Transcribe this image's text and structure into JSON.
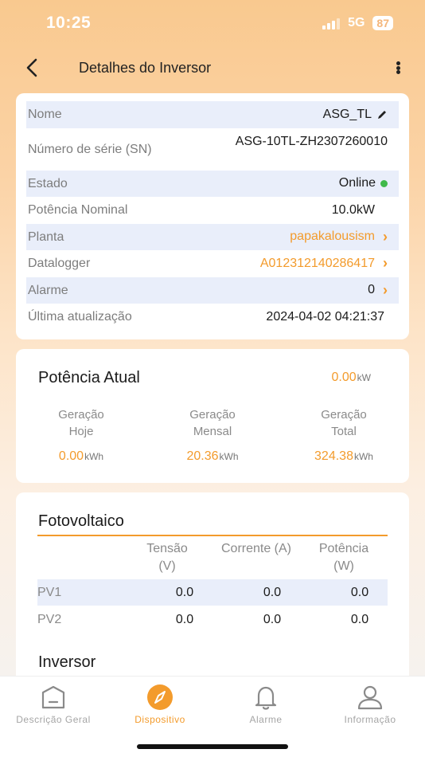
{
  "status_bar": {
    "time": "10:25",
    "network": "5G",
    "battery": "87"
  },
  "header": {
    "title": "Detalhes do Inversor"
  },
  "info": {
    "rows": [
      {
        "label": "Nome",
        "value": "ASG_TL"
      },
      {
        "label": "Número de série (SN)",
        "value": "ASG-10TL-ZH2307260010"
      },
      {
        "label": "Estado",
        "value": "Online"
      },
      {
        "label": "Potência Nominal",
        "value": "10.0kW"
      },
      {
        "label": "Planta",
        "value": "papakalousism"
      },
      {
        "label": "Datalogger",
        "value": "A012312140286417"
      },
      {
        "label": "Alarme",
        "value": "0"
      },
      {
        "label": "Última atualização",
        "value": "2024-04-02 04:21:37"
      }
    ],
    "status_color": "#3fb94a"
  },
  "power": {
    "title": "Potência Atual",
    "current_value": "0.00",
    "current_unit": "kW",
    "gen": [
      {
        "label": "Geração Hoje",
        "value": "0.00",
        "unit": "kWh"
      },
      {
        "label": "Geração Mensal",
        "value": "20.36",
        "unit": "kWh"
      },
      {
        "label": "Geração Total",
        "value": "324.38",
        "unit": "kWh"
      }
    ]
  },
  "pv": {
    "title": "Fotovoltaico",
    "headers": [
      "Tensão (V)",
      "Corrente (A)",
      "Potência (W)"
    ],
    "rows": [
      {
        "name": "PV1",
        "values": [
          "0.0",
          "0.0",
          "0.0"
        ]
      },
      {
        "name": "PV2",
        "values": [
          "0.0",
          "0.0",
          "0.0"
        ]
      }
    ]
  },
  "inverter_section": {
    "title": "Inversor"
  },
  "tabs": [
    {
      "label": "Descrição Geral",
      "icon": "overview-icon"
    },
    {
      "label": "Dispositivo",
      "icon": "compass-icon",
      "active": true
    },
    {
      "label": "Alarme",
      "icon": "bell-icon"
    },
    {
      "label": "Informação",
      "icon": "user-icon"
    }
  ],
  "colors": {
    "accent": "#f39b2c",
    "row_highlight": "#e9eefa"
  }
}
